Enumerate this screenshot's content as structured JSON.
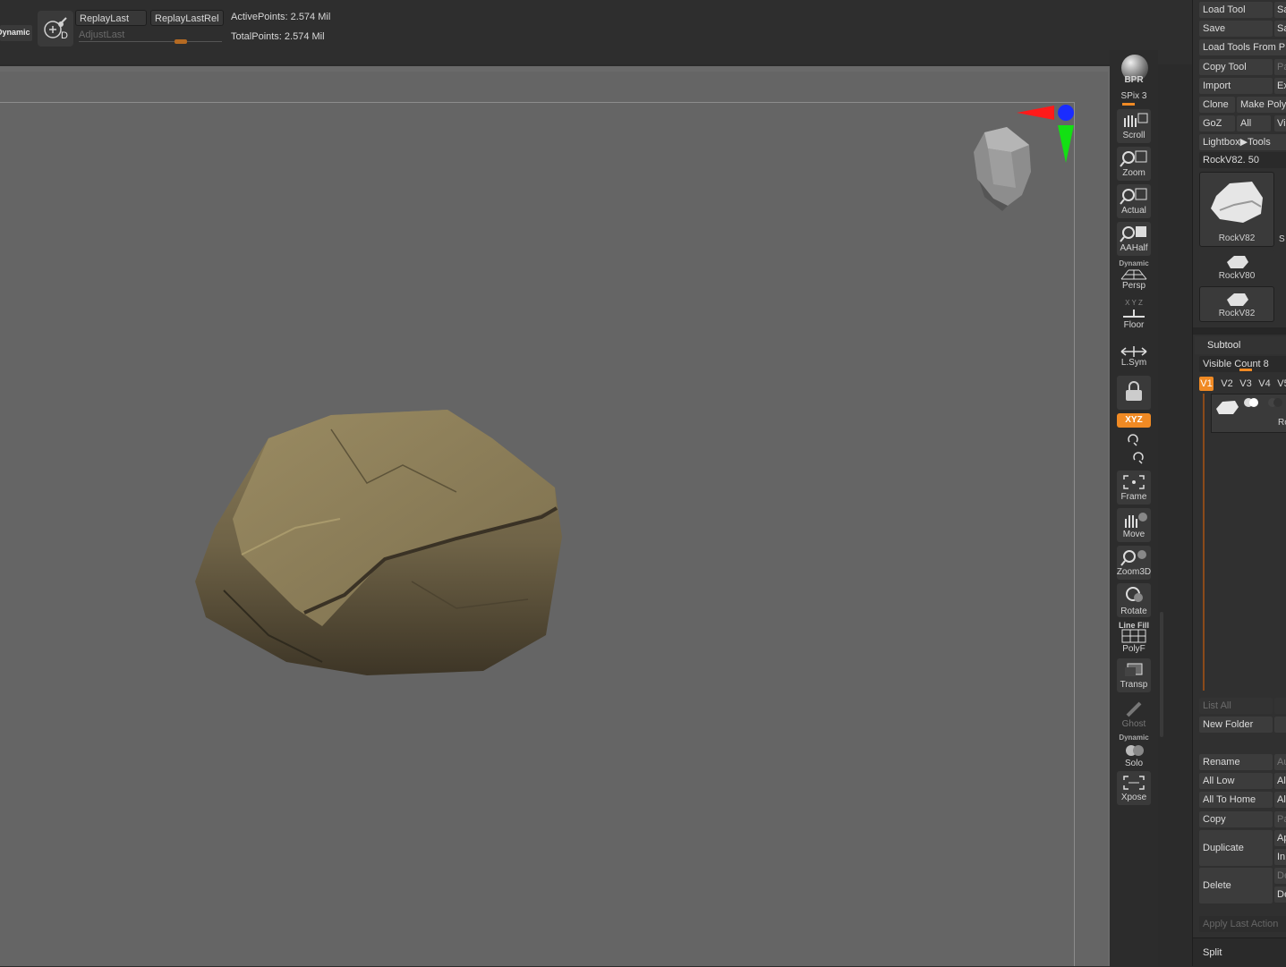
{
  "topbar": {
    "dynamic_label": "Dynamic",
    "dynamic_key": "D",
    "replay_last": "ReplayLast",
    "replay_last_rel": "ReplayLastRel",
    "adjust_last": "AdjustLast",
    "active_points": "ActivePoints: 2.574 Mil",
    "total_points": "TotalPoints: 2.574 Mil"
  },
  "shelf": {
    "bpr": "BPR",
    "spix": "SPix 3",
    "scroll": "Scroll",
    "zoom": "Zoom",
    "actual": "Actual",
    "aahalf": "AAHalf",
    "persp_tag": "Dynamic",
    "persp": "Persp",
    "floor_axes": "X Y Z",
    "floor": "Floor",
    "lsym": "L.Sym",
    "xyz": "XYZ",
    "frame": "Frame",
    "move": "Move",
    "zoom3d": "Zoom3D",
    "rotate": "Rotate",
    "polyf_tag": "Line Fill",
    "polyf": "PolyF",
    "transp": "Transp",
    "ghost": "Ghost",
    "solo_tag": "Dynamic",
    "solo": "Solo",
    "xpose": "Xpose"
  },
  "tool_panel": {
    "load_tool": "Load Tool",
    "save_as": "Sa",
    "save": "Save",
    "save2": "Sa",
    "load_tools_from": "Load Tools From P",
    "copy_tool": "Copy Tool",
    "paste": "Pa",
    "import": "Import",
    "export": "Ex",
    "clone": "Clone",
    "make_poly": "Make Poly",
    "goz": "GoZ",
    "all": "All",
    "visible": "Vi",
    "lightbox_tools": "Lightbox▶Tools",
    "current_tool": "RockV82. 50",
    "thumbs": [
      "RockV82",
      "RockV80",
      "RockV82"
    ],
    "side_letter": "S"
  },
  "subtool": {
    "title": "Subtool",
    "visible_count": "Visible Count 8",
    "versions": [
      "V1",
      "V2",
      "V3",
      "V4",
      "V5"
    ],
    "active_version": "V1",
    "item_label": "RockV",
    "list_all": "List All",
    "new_folder": "New Folder",
    "rename": "Rename",
    "rename2": "Au",
    "all_low": "All Low",
    "all_low2": "Al",
    "all_to_home": "All To Home",
    "all_to_home2": "Al",
    "copy": "Copy",
    "copy2": "Pa",
    "duplicate": "Duplicate",
    "dup_a": "Ap",
    "dup_b": "In",
    "delete": "Delete",
    "del_a": "De",
    "del_b": "De",
    "apply_last_action": "Apply Last Action",
    "split": "Split"
  },
  "colors": {
    "accent_orange": "#f08a24",
    "canvas_bg": "#656565",
    "axis_red": "#ff1a1a",
    "axis_green": "#13e013",
    "axis_blue": "#1a2cff"
  }
}
